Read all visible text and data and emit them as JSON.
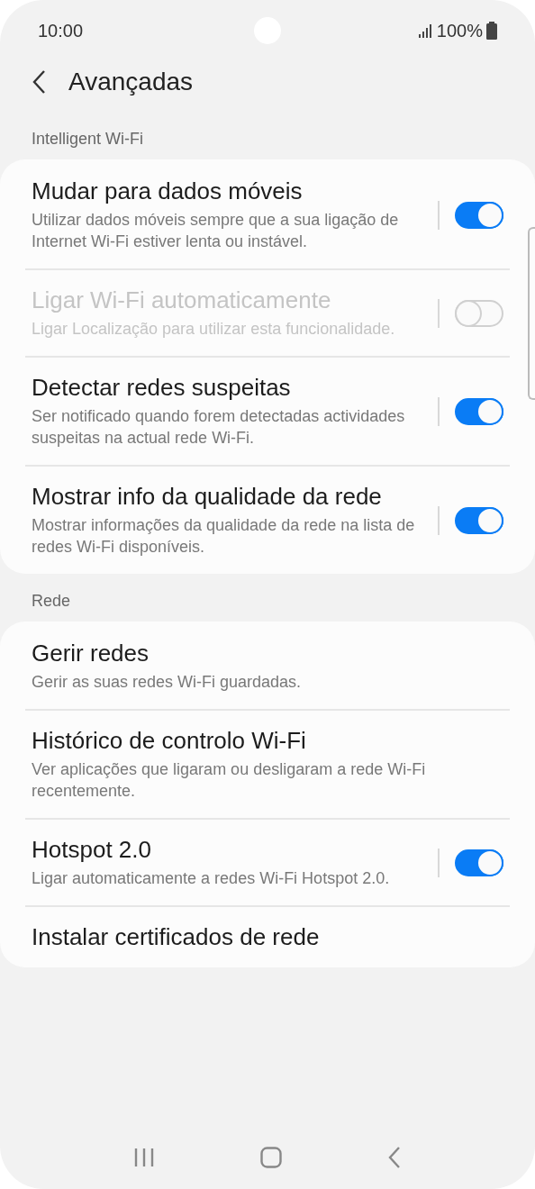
{
  "status_bar": {
    "time": "10:00",
    "battery": "100%"
  },
  "header": {
    "title": "Avançadas"
  },
  "sections": [
    {
      "title": "Intelligent Wi-Fi",
      "items": [
        {
          "kind": "switch",
          "title": "Mudar para dados móveis",
          "subtitle": "Utilizar dados móveis sempre que a sua ligação de Internet Wi-Fi estiver lenta ou instável.",
          "on": true,
          "disabled": false
        },
        {
          "kind": "switch",
          "title": "Ligar Wi-Fi automaticamente",
          "subtitle": "Ligar Localização para utilizar esta funcionalidade.",
          "on": false,
          "disabled": true
        },
        {
          "kind": "switch",
          "title": "Detectar redes suspeitas",
          "subtitle": "Ser notificado quando forem detectadas actividades suspeitas na actual rede Wi-Fi.",
          "on": true,
          "disabled": false
        },
        {
          "kind": "switch",
          "title": "Mostrar info da qualidade da rede",
          "subtitle": "Mostrar informações da qualidade da rede na lista de redes Wi-Fi disponíveis.",
          "on": true,
          "disabled": false
        }
      ]
    },
    {
      "title": "Rede",
      "items": [
        {
          "kind": "link",
          "title": "Gerir redes",
          "subtitle": "Gerir as suas redes Wi-Fi guardadas."
        },
        {
          "kind": "link",
          "title": "Histórico de controlo Wi-Fi",
          "subtitle": "Ver aplicações que ligaram ou desligaram a rede Wi-Fi recentemente."
        },
        {
          "kind": "switch",
          "title": "Hotspot 2.0",
          "subtitle": "Ligar automaticamente a redes Wi-Fi Hotspot 2.0.",
          "on": true,
          "disabled": false
        },
        {
          "kind": "link",
          "title": "Instalar certificados de rede"
        }
      ]
    }
  ]
}
